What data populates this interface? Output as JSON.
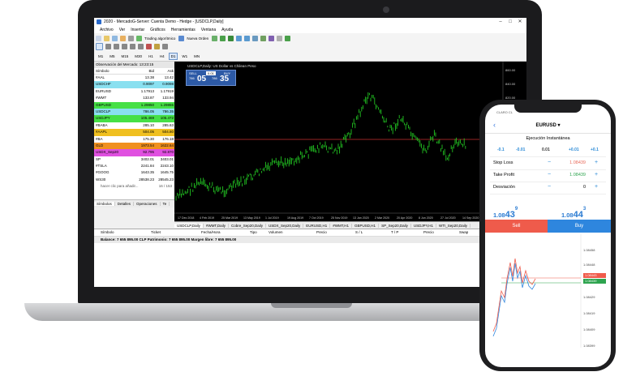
{
  "app": {
    "title": "2020 - MercadoG-Server: Cuenta Demo - Hedge - [USDCLP,Daily]",
    "menu": [
      "Archivo",
      "Ver",
      "Insertar",
      "Gráficos",
      "Herramientas",
      "Ventana",
      "Ayuda"
    ],
    "toolbar": {
      "algo_trading": "Trading algorítmico",
      "new_order": "Nueva Orden"
    },
    "timeframes": [
      "M1",
      "M5",
      "M15",
      "M30",
      "H1",
      "H4",
      "D1",
      "W1",
      "MN"
    ],
    "active_timeframe": "D1"
  },
  "market_watch": {
    "title": "Observación del Mercado: 13:23:15",
    "headers": {
      "symbol": "Símbolo",
      "bid": "Bid",
      "ask": "Ask"
    },
    "rows": [
      {
        "symbol": "#AAL",
        "bid": "13.38",
        "ask": "13.42",
        "color": "#ffffff"
      },
      {
        "symbol": "USDCHF",
        "bid": "0.9097",
        "ask": "0.9098",
        "color": "#8ae0f0"
      },
      {
        "symbol": "EURUSD",
        "bid": "1.17913",
        "ask": "1.17919",
        "color": "#ffffff"
      },
      {
        "symbol": "#WMT",
        "bid": "133.87",
        "ask": "133.94",
        "color": "#ffffff"
      },
      {
        "symbol": "GBPUSD",
        "bid": "1.29850",
        "ask": "1.29855",
        "color": "#46e046"
      },
      {
        "symbol": "USDCLP",
        "bid": "786.05",
        "ask": "786.35",
        "color": "#8ae0f0"
      },
      {
        "symbol": "USDJPY",
        "bid": "105.469",
        "ask": "105.472",
        "color": "#46e046"
      },
      {
        "symbol": "#BABA",
        "bid": "285.10",
        "ask": "285.63",
        "color": "#ffffff"
      },
      {
        "symbol": "#AAPL",
        "bid": "504.05",
        "ask": "504.80",
        "color": "#f0c020"
      },
      {
        "symbol": "#BA",
        "bid": "175.30",
        "ask": "176.18",
        "color": "#ffffff"
      },
      {
        "symbol": "GLD",
        "bid": "1973.54",
        "ask": "1622.64",
        "color": "#f09020"
      },
      {
        "symbol": "USDX_Sep20",
        "bid": "92.795",
        "ask": "92.870",
        "color": "#e050e0"
      },
      {
        "symbol": "SP",
        "bid": "3402.01",
        "ask": "3403.01",
        "color": "#ffffff"
      },
      {
        "symbol": "#TSLA",
        "bid": "2241.84",
        "ask": "2243.10",
        "color": "#ffffff"
      },
      {
        "symbol": "#GOOG",
        "bid": "1643.35",
        "ask": "1645.75",
        "color": "#ffffff"
      },
      {
        "symbol": "WS30",
        "bid": "28538.23",
        "ask": "28545.23",
        "color": "#ffffff"
      }
    ],
    "add_hint": "hacer clic para añadir...",
    "count": "16 / 153",
    "tabs": [
      "Símbolos",
      "Detalles",
      "Operaciones",
      "Te"
    ]
  },
  "chart": {
    "title": "USDCLP,Daily:  US Dollar vs Chilean Peso",
    "sell_label": "SELL",
    "buy_label": "BUY",
    "lot": "0.01",
    "bid_prefix": "786",
    "bid_big": "05",
    "ask_prefix": "786",
    "ask_big": "35",
    "x_labels": [
      "17 Dec 2018",
      "4 Feb 2019",
      "25 Mar 2019",
      "13 May 2019",
      "1 Jul 2019",
      "19 Aug 2019",
      "7 Oct 2019",
      "25 Nov 2019",
      "13 Jan 2020",
      "2 Mar 2020",
      "20 Apr 2020",
      "8 Jun 2020",
      "27 Jul 2020",
      "14 Sep 2020",
      "2 Nov 2020"
    ],
    "y_labels": [
      "860.00",
      "840.00",
      "820.00",
      "800.00",
      "780.00",
      "760.00",
      "740.00",
      "720.00",
      "700.00",
      "680.00",
      "660.00"
    ],
    "tabs": [
      "USDCLP,Daily",
      "#WMT,Daily",
      "Cobre_Sep20,Daily",
      "USDX_Sep20,Daily",
      "EURUSD,H1",
      "#WMT,H1",
      "GBPUSD,H1",
      "SP_Sep20,Daily",
      "USDJPY,H1",
      "WTI_Sep20,Daily"
    ]
  },
  "terminal": {
    "headers": [
      "Símbolo",
      "Ticket",
      "Fecha/Hora",
      "Tipo",
      "Volumen",
      "Precio",
      "S / L",
      "T / P",
      "Precio",
      "Swap"
    ],
    "balance": "Balance: 7 655 895.00 CLP  Patrimonio: 7 655 895.00  Margen libre: 7 655 895.00"
  },
  "phone": {
    "carrier": "CLARO CL",
    "symbol": "EURUSD ▾",
    "mode": "Ejecución Instantánea",
    "deviation_steps": [
      "-0.1",
      "-0.01",
      "0.01",
      "+0.01",
      "+0.1"
    ],
    "stop_loss": {
      "label": "Stop Loss",
      "value": "1.08439"
    },
    "take_profit": {
      "label": "Take Profit",
      "value": "1.08439"
    },
    "deviation": {
      "label": "Desviación",
      "value": "0"
    },
    "sell_quote": {
      "prefix": "1.08",
      "big": "43",
      "sup": "9"
    },
    "buy_quote": {
      "prefix": "1.08",
      "big": "44",
      "sup": "3"
    },
    "sell_label": "Sell",
    "buy_label": "Buy",
    "axis_labels": [
      "1.08458",
      "1.08448",
      "1.08443",
      "1.08439",
      "1.08429",
      "1.08419",
      "1.08409",
      "1.08399"
    ],
    "colors": {
      "sell": "#ef5b4b",
      "buy": "#2e86de"
    }
  }
}
